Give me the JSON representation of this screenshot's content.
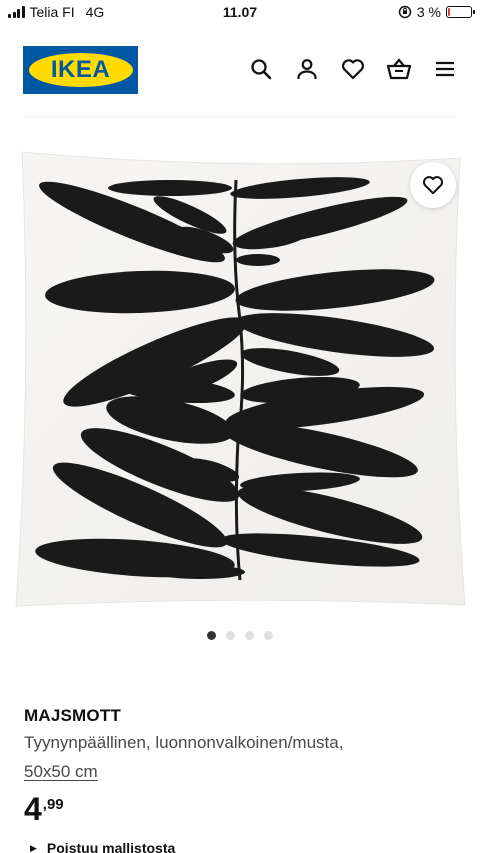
{
  "status_bar": {
    "carrier": "Telia FI",
    "network": "4G",
    "time": "11.07",
    "battery_percent": "3 %",
    "battery_level": 0.03
  },
  "header": {
    "logo_text": "IKEA",
    "icons": [
      "search-icon",
      "user-icon",
      "heart-icon",
      "basket-icon",
      "menu-icon"
    ]
  },
  "carousel": {
    "image_count": 4,
    "active_index": 0
  },
  "product": {
    "name": "MAJSMOTT",
    "description": "Tyynynpäällinen, luonnonvalkoinen/musta,",
    "size": "50x50 cm",
    "price_integer": "4",
    "price_decimal": ",99",
    "notice": "Poistuu mallistosta"
  },
  "colors": {
    "brand_blue": "#0058a3",
    "brand_yellow": "#ffdb00",
    "battery_low": "#e03a2f"
  }
}
